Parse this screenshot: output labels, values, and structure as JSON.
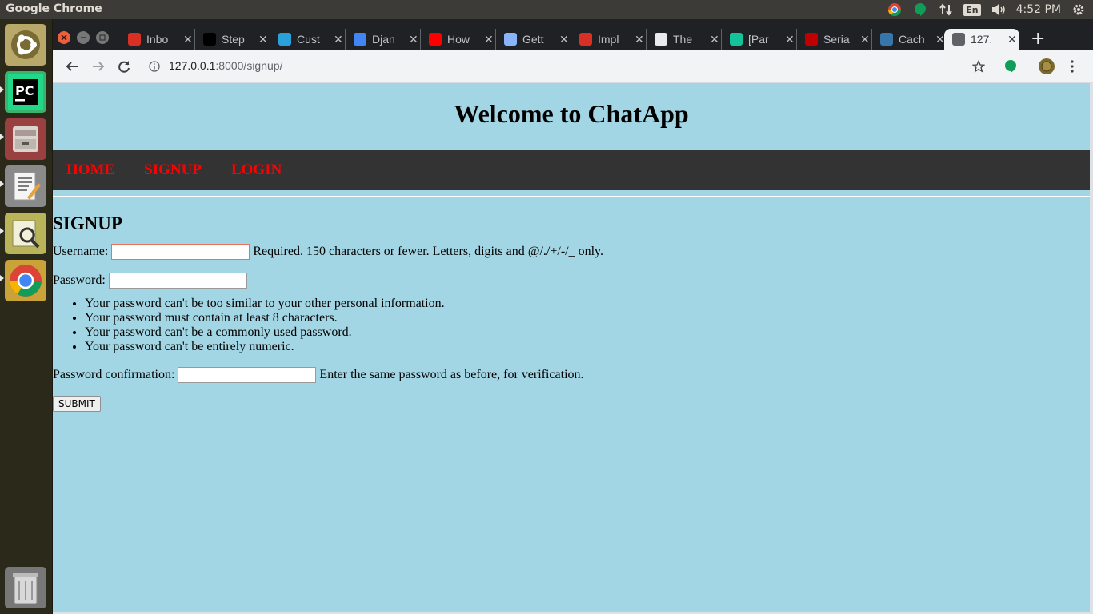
{
  "system": {
    "app_name": "Google Chrome",
    "language": "En",
    "clock": "4:52 PM"
  },
  "browser": {
    "tabs": [
      {
        "label": "Inbo",
        "icon": "gmail-icon",
        "color": "#d93025"
      },
      {
        "label": "Step",
        "icon": "jetbrains-icon",
        "color": "#000000"
      },
      {
        "label": "Cust",
        "icon": "django-rest-icon",
        "color": "#2aa1d9"
      },
      {
        "label": "Djan",
        "icon": "docs-icon",
        "color": "#4285f4"
      },
      {
        "label": "How",
        "icon": "youtube-icon",
        "color": "#ff0000"
      },
      {
        "label": "Gett",
        "icon": "book-icon",
        "color": "#8ab4f8"
      },
      {
        "label": "Impl",
        "icon": "code-shield-icon",
        "color": "#d93025"
      },
      {
        "label": "The",
        "icon": "github-icon",
        "color": "#e8eaed"
      },
      {
        "label": "[Par",
        "icon": "grammarly-icon",
        "color": "#15c39a"
      },
      {
        "label": "Seria",
        "icon": "serial-icon",
        "color": "#c00000"
      },
      {
        "label": "Cach",
        "icon": "python-icon",
        "color": "#3776ab"
      },
      {
        "label": "127.",
        "icon": "globe-icon",
        "color": "#5f6368"
      }
    ],
    "url_host": "127.0.0.1",
    "url_path": ":8000/signup/"
  },
  "page": {
    "site_title": "Welcome to ChatApp",
    "nav": [
      "HOME",
      "SIGNUP",
      "LOGIN"
    ],
    "form_title": "SIGNUP",
    "username_label": "Username:",
    "username_help": "Required. 150 characters or fewer. Letters, digits and @/./+/-/_ only.",
    "password_label": "Password:",
    "password_help": [
      "Your password can't be too similar to your other personal information.",
      "Your password must contain at least 8 characters.",
      "Your password can't be a commonly used password.",
      "Your password can't be entirely numeric."
    ],
    "confirm_label": "Password confirmation:",
    "confirm_help": "Enter the same password as before, for verification.",
    "submit_label": "SUBMIT",
    "colors": {
      "background": "#a3d6e4",
      "nav_bg": "#333333",
      "nav_link": "#ff0000"
    }
  }
}
